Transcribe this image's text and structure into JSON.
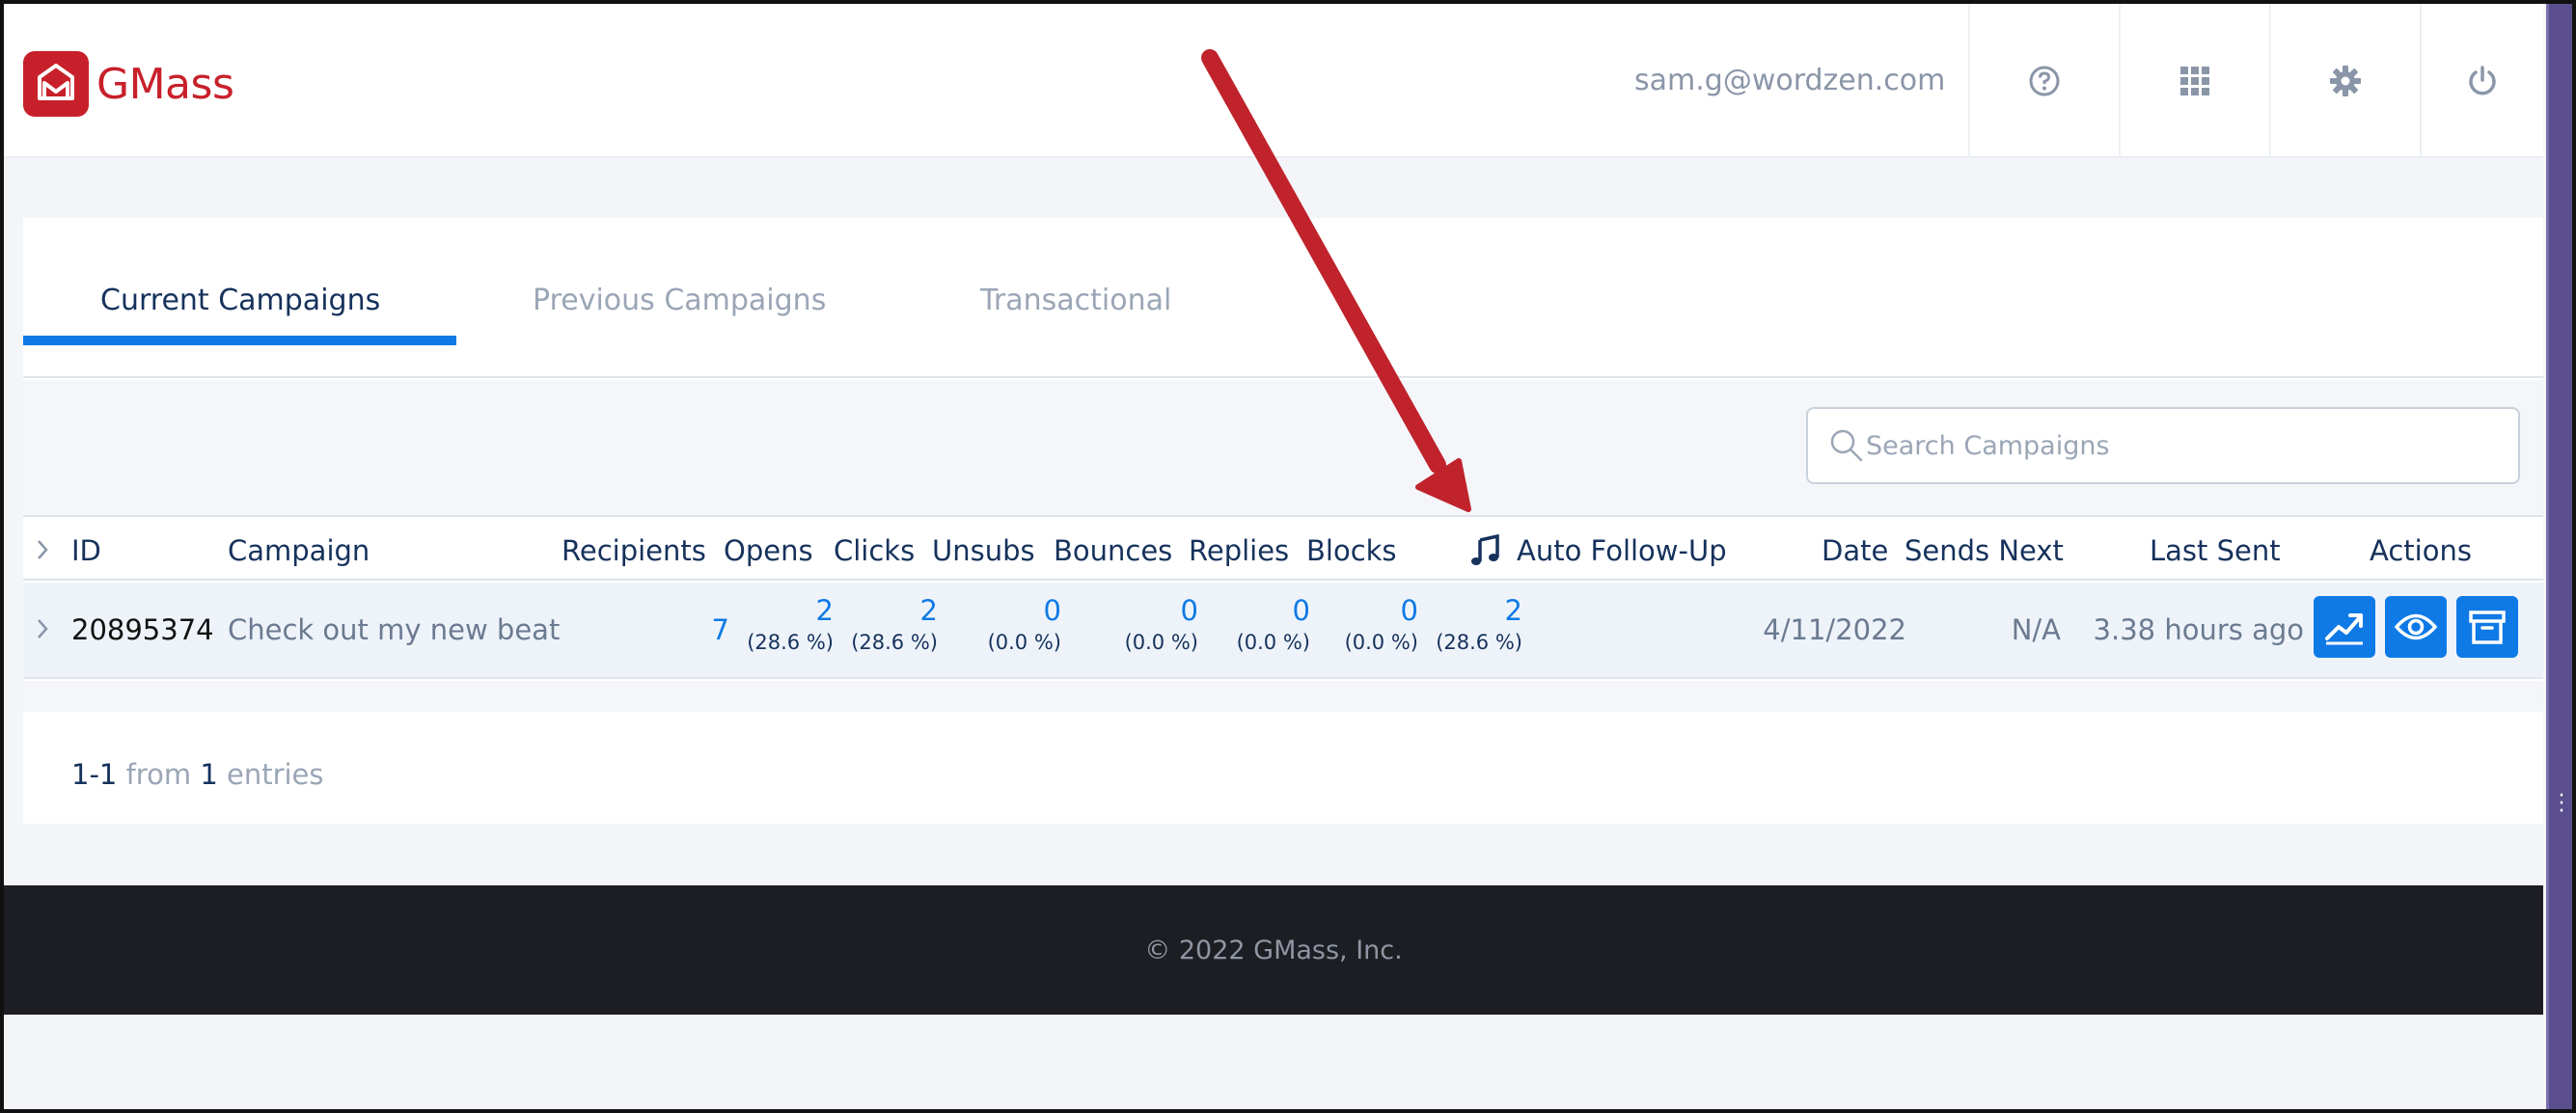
{
  "app": {
    "brand": "GMass",
    "user_email": "sam.g@wordzen.com",
    "header_icons": [
      "help-icon",
      "apps-grid-icon",
      "settings-gear-icon",
      "power-icon"
    ]
  },
  "tabs": [
    {
      "label": "Current Campaigns",
      "active": true
    },
    {
      "label": "Previous Campaigns",
      "active": false
    },
    {
      "label": "Transactional",
      "active": false
    }
  ],
  "search": {
    "placeholder": "Search Campaigns",
    "value": ""
  },
  "table": {
    "headers": {
      "id": "ID",
      "campaign": "Campaign",
      "recipients": "Recipients",
      "opens": "Opens",
      "clicks": "Clicks",
      "unsubs": "Unsubs",
      "bounces": "Bounces",
      "replies": "Replies",
      "blocks": "Blocks",
      "auto_follow_up": "Auto Follow-Up",
      "date": "Date",
      "sends_next": "Sends Next",
      "last_sent": "Last Sent",
      "actions": "Actions"
    },
    "rows": [
      {
        "id": "20895374",
        "campaign": "Check out my new beat",
        "recipients": "7",
        "opens": {
          "value": "2",
          "pct": "(28.6 %)"
        },
        "clicks": {
          "value": "2",
          "pct": "(28.6 %)"
        },
        "unsubs": {
          "value": "0",
          "pct": "(0.0 %)"
        },
        "bounces": {
          "value": "0",
          "pct": "(0.0 %)"
        },
        "replies": {
          "value": "0",
          "pct": "(0.0 %)"
        },
        "blocks": {
          "value": "0",
          "pct": "(0.0 %)"
        },
        "auto_follow_up": {
          "value": "2",
          "pct": "(28.6 %)"
        },
        "date": "4/11/2022",
        "sends_next": "N/A",
        "last_sent": "3.38 hours ago",
        "actions": [
          "reports-chart-icon",
          "view-eye-icon",
          "archive-box-icon"
        ]
      }
    ]
  },
  "pagination": {
    "range": "1-1",
    "from_label": "from",
    "total": "1",
    "entries_label": "entries"
  },
  "footer": {
    "copyright": "© 2022 GMass, Inc."
  },
  "colors": {
    "brand_red": "#c8202a",
    "accent_blue": "#0f7ae5",
    "annotation_arrow": "#c0232b",
    "footer_bg": "#1d1e23",
    "text_dark": "#16325c",
    "text_muted": "#9aa6b6"
  }
}
